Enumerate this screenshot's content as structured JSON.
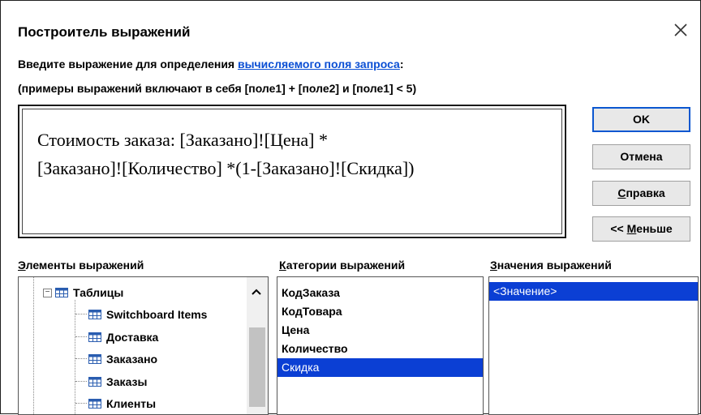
{
  "dialog": {
    "title": "Построитель выражений",
    "instruction_prefix": "Введите выражение для определения ",
    "instruction_link": "вычисляемого поля запроса",
    "instruction_suffix": ":",
    "examples": "(примеры выражений включают в себя [поле1] + [поле2] и [поле1] < 5)",
    "close_icon": "close-icon"
  },
  "expression": {
    "text": "Стоимость заказа: [Заказано]![Цена] *\n[Заказано]![Количество] *(1-[Заказано]![Скидка])"
  },
  "buttons": {
    "ok": "OK",
    "cancel": "Отмена",
    "help_hotkey": "С",
    "help_rest": "правка",
    "less_prefix": "<< ",
    "less_hotkey": "М",
    "less_rest": "еньше"
  },
  "sections": {
    "elements": {
      "hotkey": "Э",
      "rest": "лементы выражений"
    },
    "categories": {
      "hotkey": "К",
      "rest": "атегории выражений"
    },
    "values": {
      "hotkey": "З",
      "rest": "начения выражений"
    }
  },
  "elements_tree": {
    "root": {
      "label": "Таблицы",
      "icon": "table-icon",
      "expanded": true
    },
    "children": [
      {
        "label": "Switchboard Items",
        "icon": "table-icon"
      },
      {
        "label": "Доставка",
        "icon": "table-icon"
      },
      {
        "label": "Заказано",
        "icon": "table-icon",
        "selected": true
      },
      {
        "label": "Заказы",
        "icon": "table-icon"
      },
      {
        "label": "Клиенты",
        "icon": "table-icon"
      }
    ]
  },
  "categories_list": [
    "КодЗаказа",
    "КодТовара",
    "Цена",
    "Количество",
    "Скидка"
  ],
  "categories_selected": "Скидка",
  "values_list": [
    "<Значение>"
  ],
  "colors": {
    "selection": "#0b3fd4",
    "link": "#0b4fd4",
    "ok_border": "#0b57d0"
  }
}
